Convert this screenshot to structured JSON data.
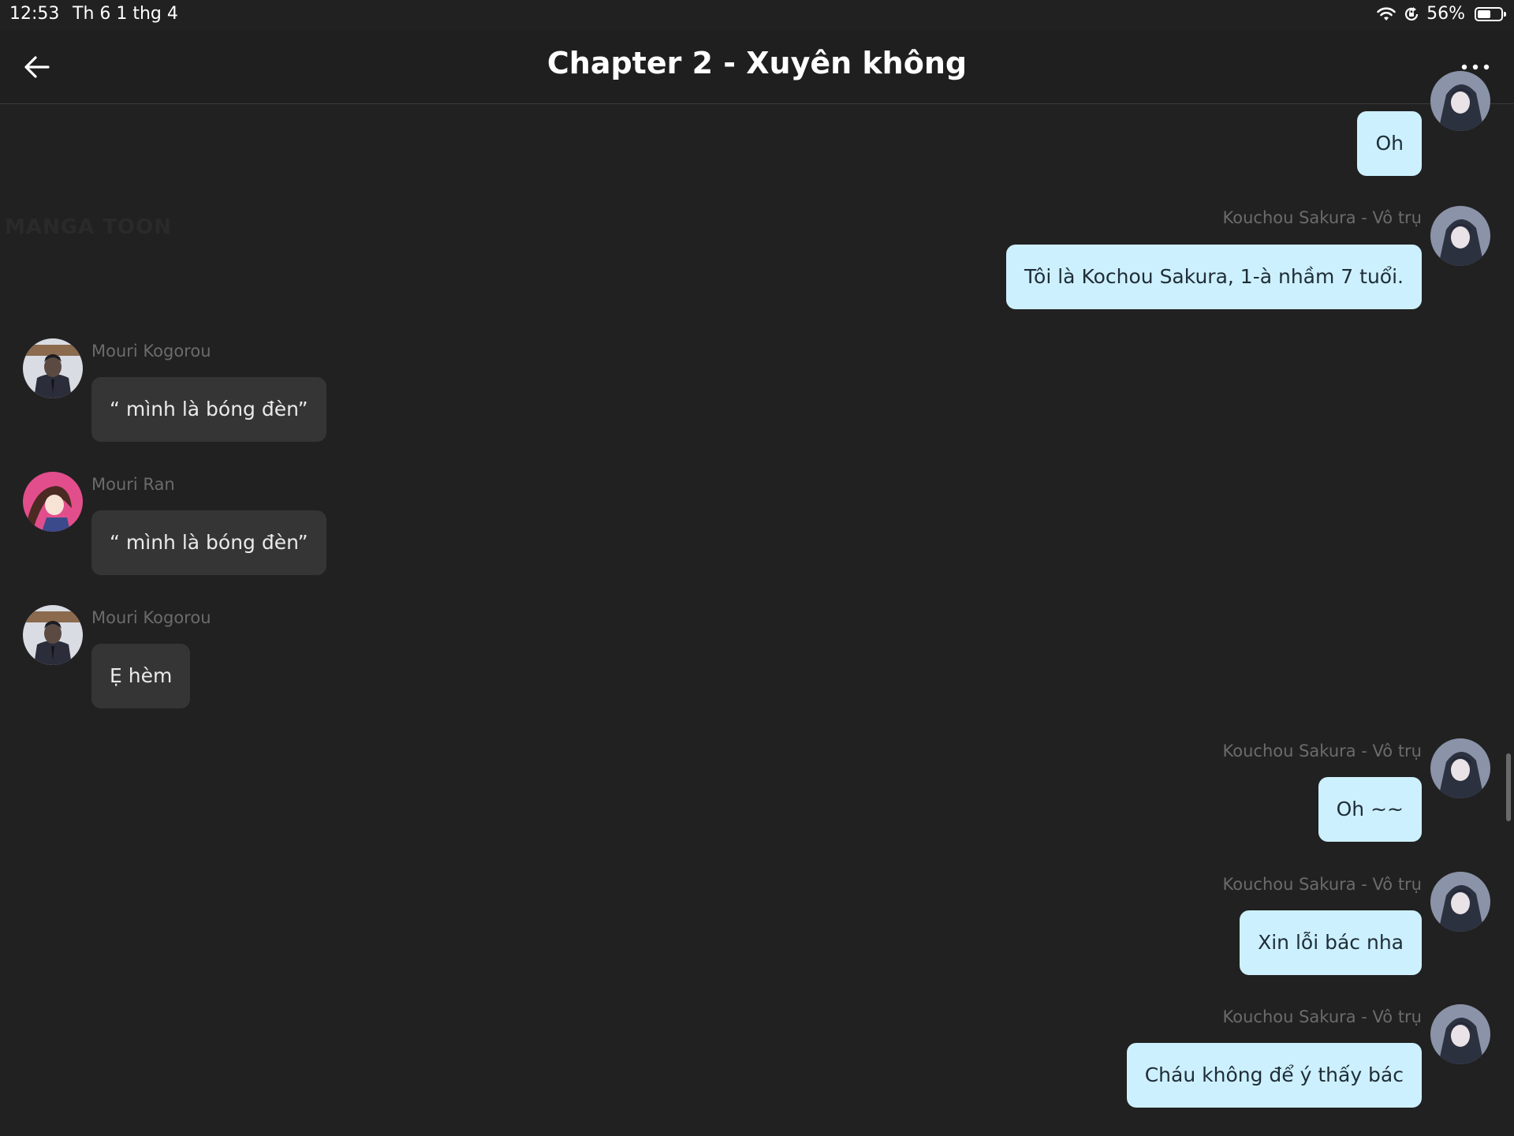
{
  "status": {
    "time": "12:53",
    "date": "Th 6 1 thg 4",
    "battery": "56%",
    "battery_level": 0.56
  },
  "header": {
    "title": "Chapter 2 - Xuyên không"
  },
  "watermark": "MANGA TOON",
  "messages": [
    {
      "sender": "",
      "text": "Oh",
      "side": "right"
    },
    {
      "sender": "Kouchou Sakura - Vô trụ",
      "text": "Tôi là Kochou Sakura, 1-à nhầm 7 tuổi.",
      "side": "right"
    },
    {
      "sender": "Mouri Kogorou",
      "text": "“ mình là bóng đèn”",
      "side": "left"
    },
    {
      "sender": "Mouri Ran",
      "text": "“ mình là bóng đèn”",
      "side": "left"
    },
    {
      "sender": "Mouri Kogorou",
      "text": "Ẹ hèm",
      "side": "left"
    },
    {
      "sender": "Kouchou Sakura - Vô trụ",
      "text": "Oh ~~",
      "side": "right"
    },
    {
      "sender": "Kouchou Sakura - Vô trụ",
      "text": "Xin lỗi bác nha",
      "side": "right"
    },
    {
      "sender": "Kouchou Sakura - Vô trụ",
      "text": "Cháu không để ý thấy bác",
      "side": "right"
    }
  ],
  "colors": {
    "background": "#212121",
    "outgoing_bubble": "#cdf0ff",
    "incoming_bubble": "#353535",
    "sender_name": "#6b6b6b"
  }
}
